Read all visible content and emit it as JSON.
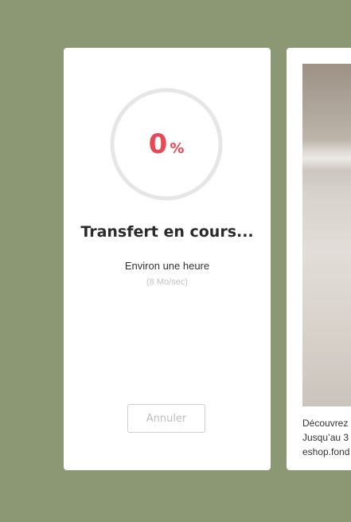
{
  "transfer": {
    "progress_percent": 0,
    "percent_value": "0",
    "percent_unit": "%",
    "title": "Transfert en cours...",
    "eta": "Environ une heure",
    "speed": "(8 Mo/sec)",
    "cancel_label": "Annuler",
    "accent_color": "#e84a55"
  },
  "ad": {
    "lines": [
      "Découvrez",
      "Jusqu’au 3",
      "eshop.fond"
    ]
  },
  "colors": {
    "background": "#8c9774",
    "card": "#ffffff",
    "ring_track": "#e6e6e6"
  }
}
